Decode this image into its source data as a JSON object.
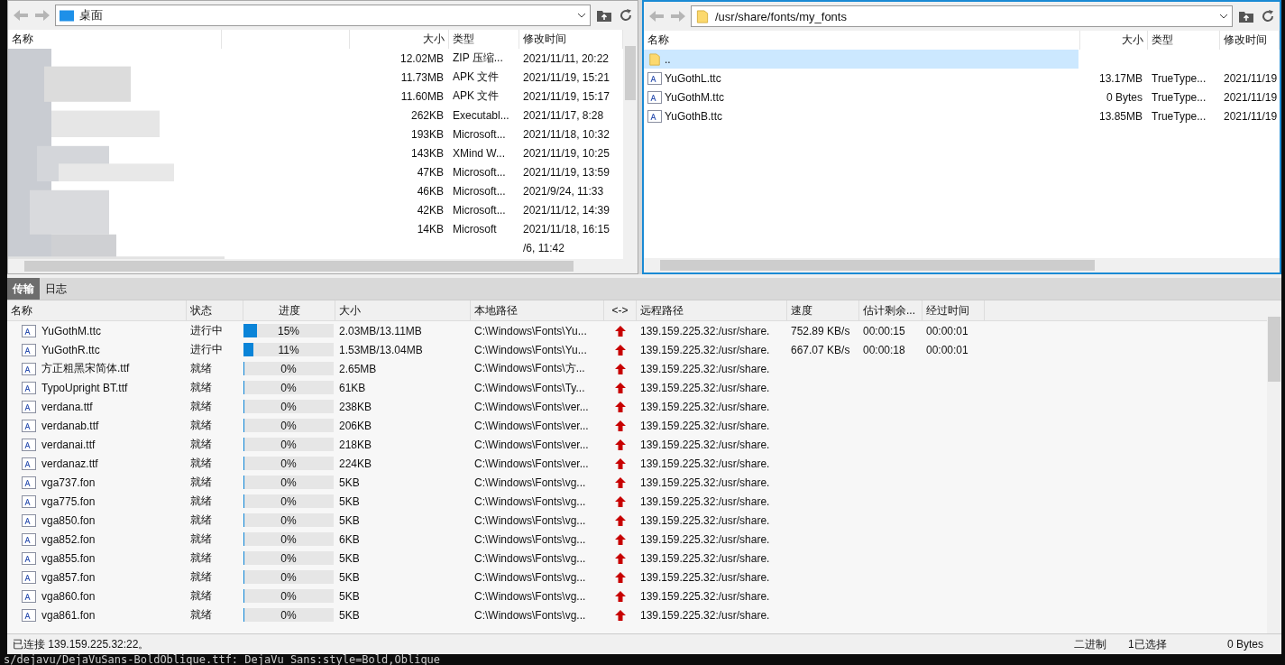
{
  "left_pane": {
    "path": "桌面",
    "columns": [
      "名称",
      "大小",
      "类型",
      "修改时间"
    ],
    "rows": [
      {
        "size": "12.02MB",
        "type": "ZIP 压缩...",
        "modified": "2021/11/11, 20:22"
      },
      {
        "size": "11.73MB",
        "type": "APK 文件",
        "modified": "2021/11/19, 15:21"
      },
      {
        "size": "11.60MB",
        "type": "APK 文件",
        "modified": "2021/11/19, 15:17"
      },
      {
        "size": "262KB",
        "type": "Executabl...",
        "modified": "2021/11/17, 8:28"
      },
      {
        "size": "193KB",
        "type": "Microsoft...",
        "modified": "2021/11/18, 10:32"
      },
      {
        "size": "143KB",
        "type": "XMind W...",
        "modified": "2021/11/19, 10:25"
      },
      {
        "size": "47KB",
        "type": "Microsoft...",
        "modified": "2021/11/19, 13:59"
      },
      {
        "size": "46KB",
        "type": "Microsoft...",
        "modified": "2021/9/24, 11:33"
      },
      {
        "size": "42KB",
        "type": "Microsoft...",
        "modified": "2021/11/12, 14:39"
      },
      {
        "size": "14KB",
        "type": "Microsoft",
        "modified": "2021/11/18, 16:15"
      },
      {
        "modified": "/6, 11:42"
      }
    ]
  },
  "right_pane": {
    "path": "/usr/share/fonts/my_fonts",
    "columns": [
      "名称",
      "大小",
      "类型",
      "修改时间"
    ],
    "rows": [
      {
        "kind": "folder",
        "name": "..",
        "selected": true
      },
      {
        "kind": "file",
        "name": "YuGothL.ttc",
        "size": "13.17MB",
        "type": "TrueType...",
        "modified": "2021/11/19",
        "selected": false
      },
      {
        "kind": "file",
        "name": "YuGothM.ttc",
        "size": "0 Bytes",
        "type": "TrueType...",
        "modified": "2021/11/19",
        "selected": false
      },
      {
        "kind": "file",
        "name": "YuGothB.ttc",
        "size": "13.85MB",
        "type": "TrueType...",
        "modified": "2021/11/19",
        "selected": false
      }
    ]
  },
  "transfer_tabs": [
    {
      "label": "传输",
      "selected": true
    },
    {
      "label": "日志",
      "selected": false
    }
  ],
  "transfers": {
    "columns": [
      "名称",
      "状态",
      "进度",
      "大小",
      "本地路径",
      "<->",
      "远程路径",
      "速度",
      "估计剩余...",
      "经过时间"
    ],
    "rows": [
      {
        "name": "YuGothM.ttc",
        "status": "进行中",
        "level": 0.15,
        "progress": "15%",
        "size": "2.03MB/13.11MB",
        "local": "C:\\Windows\\Fonts\\Yu...",
        "remote": "139.159.225.32:/usr/share.",
        "speed": "752.89 KB/s",
        "remaining": "00:00:15",
        "elapsed": "00:00:01"
      },
      {
        "name": "YuGothR.ttc",
        "status": "进行中",
        "level": 0.11,
        "progress": "11%",
        "size": "1.53MB/13.04MB",
        "local": "C:\\Windows\\Fonts\\Yu...",
        "remote": "139.159.225.32:/usr/share.",
        "speed": "667.07 KB/s",
        "remaining": "00:00:18",
        "elapsed": "00:00:01"
      },
      {
        "name": "方正粗黑宋简体.ttf",
        "status": "就绪",
        "level": 0,
        "progress": "0%",
        "size": "2.65MB",
        "local": "C:\\Windows\\Fonts\\方...",
        "remote": "139.159.225.32:/usr/share."
      },
      {
        "name": "TypoUpright BT.ttf",
        "status": "就绪",
        "level": 0,
        "progress": "0%",
        "size": "61KB",
        "local": "C:\\Windows\\Fonts\\Ty...",
        "remote": "139.159.225.32:/usr/share."
      },
      {
        "name": "verdana.ttf",
        "status": "就绪",
        "level": 0,
        "progress": "0%",
        "size": "238KB",
        "local": "C:\\Windows\\Fonts\\ver...",
        "remote": "139.159.225.32:/usr/share."
      },
      {
        "name": "verdanab.ttf",
        "status": "就绪",
        "level": 0,
        "progress": "0%",
        "size": "206KB",
        "local": "C:\\Windows\\Fonts\\ver...",
        "remote": "139.159.225.32:/usr/share."
      },
      {
        "name": "verdanai.ttf",
        "status": "就绪",
        "level": 0,
        "progress": "0%",
        "size": "218KB",
        "local": "C:\\Windows\\Fonts\\ver...",
        "remote": "139.159.225.32:/usr/share."
      },
      {
        "name": "verdanaz.ttf",
        "status": "就绪",
        "level": 0,
        "progress": "0%",
        "size": "224KB",
        "local": "C:\\Windows\\Fonts\\ver...",
        "remote": "139.159.225.32:/usr/share."
      },
      {
        "name": "vga737.fon",
        "status": "就绪",
        "level": 0,
        "progress": "0%",
        "size": "5KB",
        "local": "C:\\Windows\\Fonts\\vg...",
        "remote": "139.159.225.32:/usr/share."
      },
      {
        "name": "vga775.fon",
        "status": "就绪",
        "level": 0,
        "progress": "0%",
        "size": "5KB",
        "local": "C:\\Windows\\Fonts\\vg...",
        "remote": "139.159.225.32:/usr/share."
      },
      {
        "name": "vga850.fon",
        "status": "就绪",
        "level": 0,
        "progress": "0%",
        "size": "5KB",
        "local": "C:\\Windows\\Fonts\\vg...",
        "remote": "139.159.225.32:/usr/share."
      },
      {
        "name": "vga852.fon",
        "status": "就绪",
        "level": 0,
        "progress": "0%",
        "size": "6KB",
        "local": "C:\\Windows\\Fonts\\vg...",
        "remote": "139.159.225.32:/usr/share."
      },
      {
        "name": "vga855.fon",
        "status": "就绪",
        "level": 0,
        "progress": "0%",
        "size": "5KB",
        "local": "C:\\Windows\\Fonts\\vg...",
        "remote": "139.159.225.32:/usr/share."
      },
      {
        "name": "vga857.fon",
        "status": "就绪",
        "level": 0,
        "progress": "0%",
        "size": "5KB",
        "local": "C:\\Windows\\Fonts\\vg...",
        "remote": "139.159.225.32:/usr/share."
      },
      {
        "name": "vga860.fon",
        "status": "就绪",
        "level": 0,
        "progress": "0%",
        "size": "5KB",
        "local": "C:\\Windows\\Fonts\\vg...",
        "remote": "139.159.225.32:/usr/share."
      },
      {
        "name": "vga861.fon",
        "status": "就绪",
        "level": 0,
        "progress": "0%",
        "size": "5KB",
        "local": "C:\\Windows\\Fonts\\vg...",
        "remote": "139.159.225.32:/usr/share."
      }
    ]
  },
  "status_bar": {
    "connection": "已连接 139.159.225.32:22。",
    "mode": "二进制",
    "selection": "1已选择",
    "bytes": "0 Bytes"
  },
  "terminal_line": "s/dejavu/DejaVuSans-BoldOblique.ttf: DejaVu Sans:style=Bold,Oblique"
}
